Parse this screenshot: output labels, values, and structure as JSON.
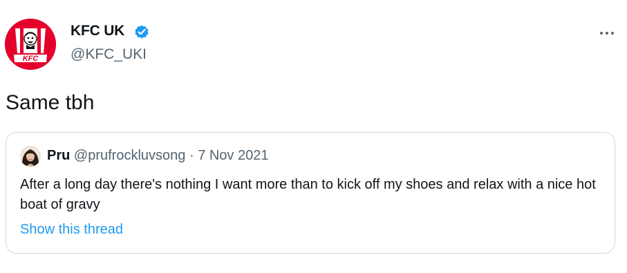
{
  "author": {
    "display_name": "KFC UK",
    "handle": "@KFC_UKI",
    "avatar_logo_text": "KFC",
    "brand_color": "#e4002b",
    "verified_color": "#1d9bf0"
  },
  "tweet": {
    "text": "Same tbh"
  },
  "quoted_tweet": {
    "name": "Pru",
    "handle": "@prufrockluvsong",
    "separator": "·",
    "date": "7 Nov 2021",
    "text": "After a long day there's nothing I want more than to kick off my shoes and relax with a nice hot boat of gravy",
    "link_label": "Show this thread",
    "link_color": "#1d9bf0"
  },
  "icons": {
    "more": "more-options-icon",
    "verified": "verified-badge-icon"
  }
}
